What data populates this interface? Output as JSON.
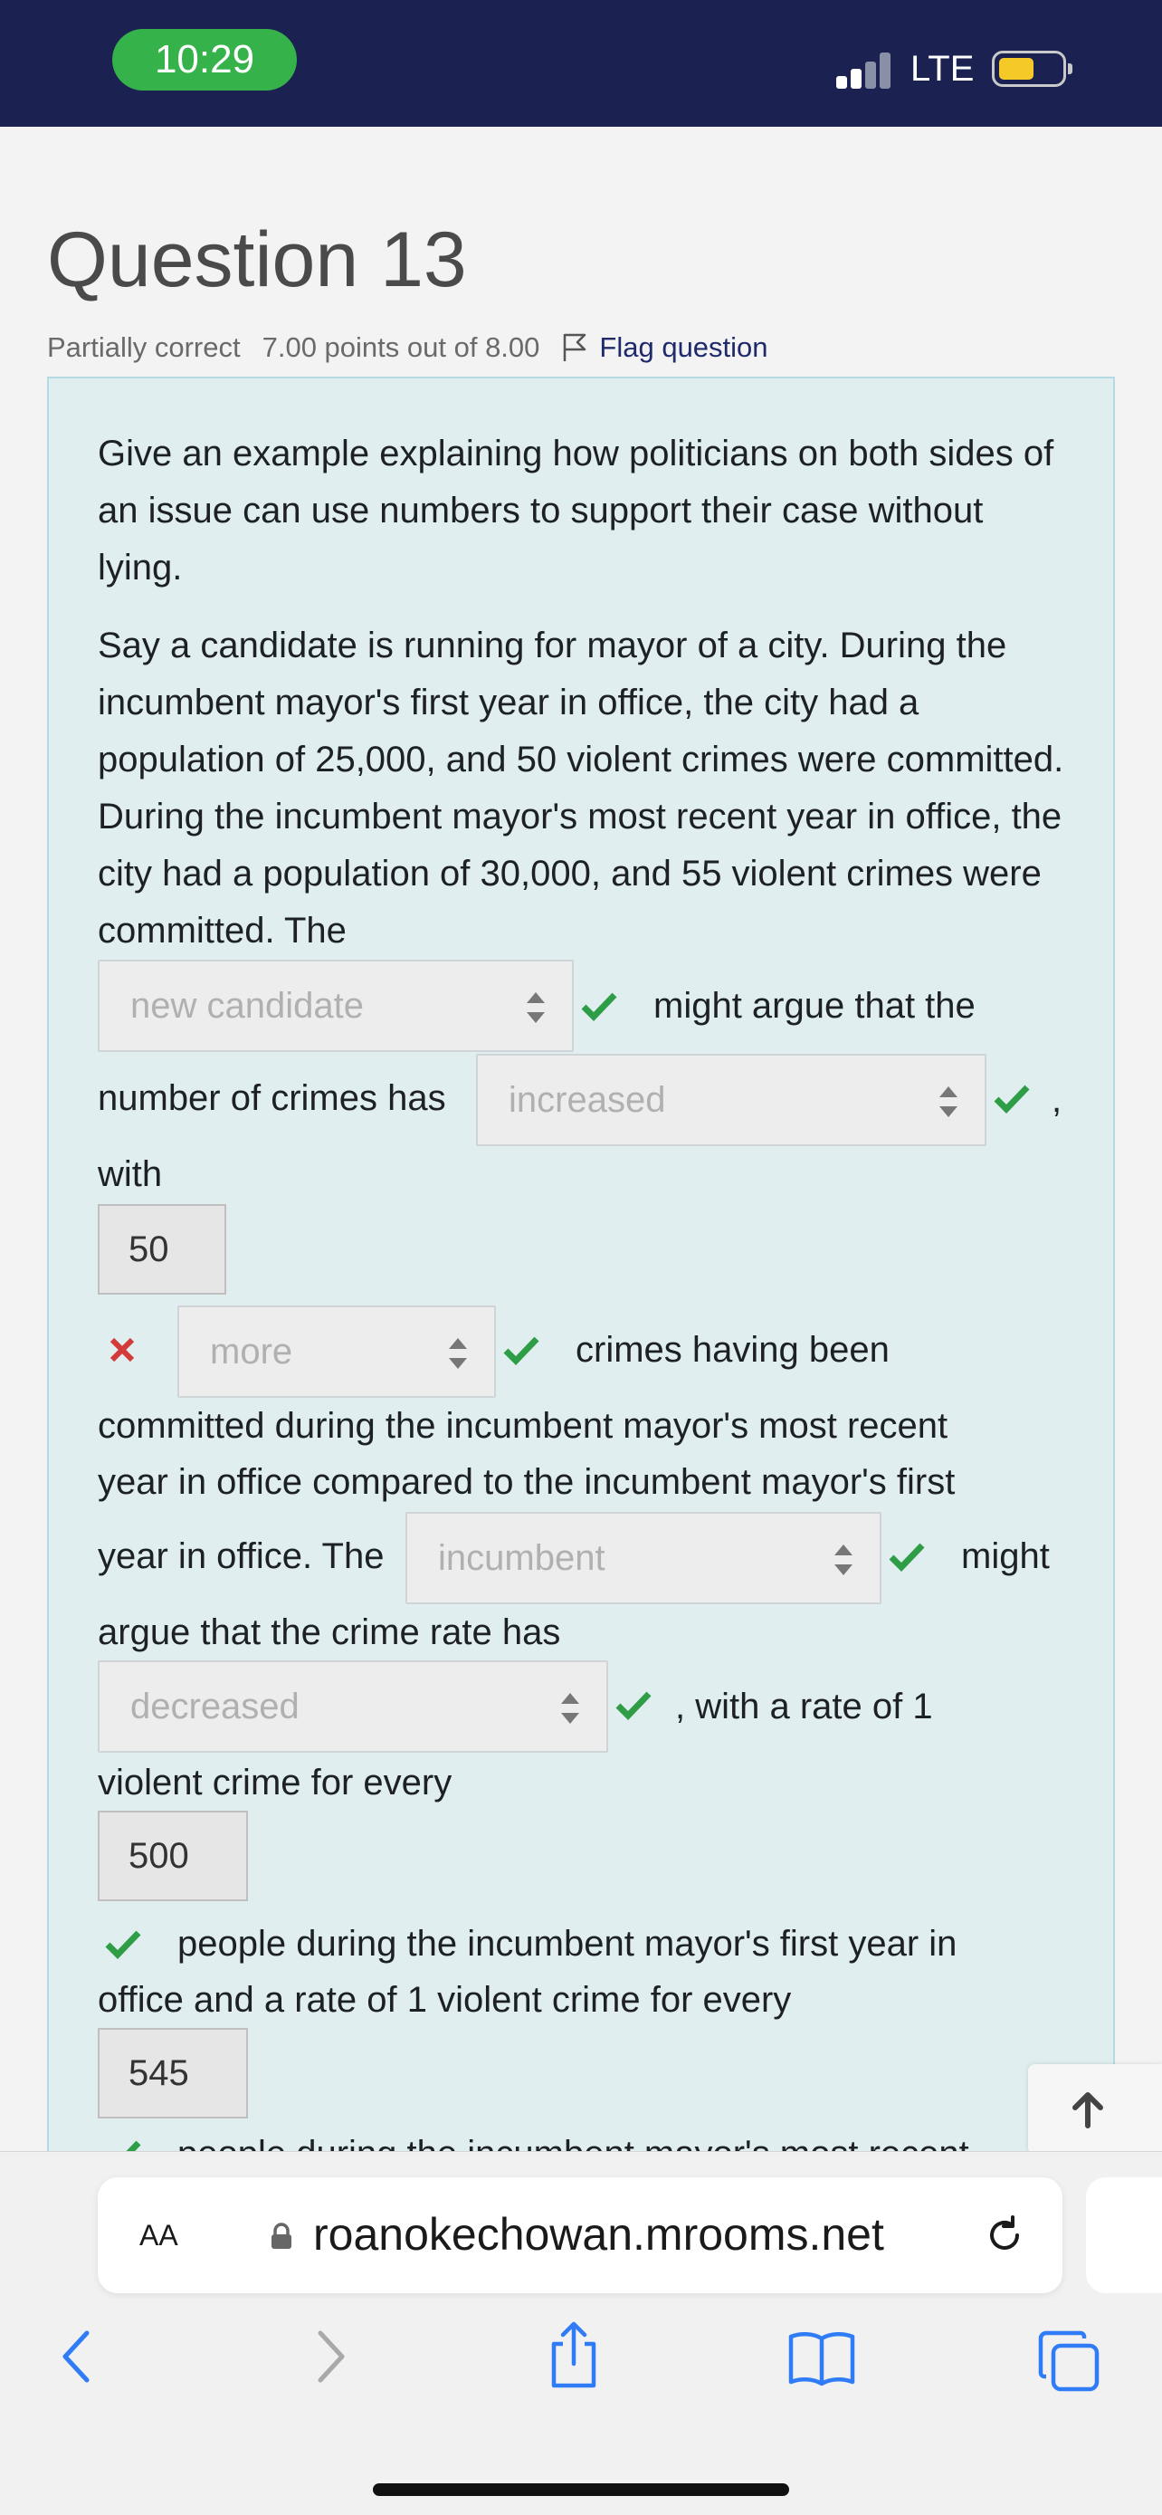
{
  "status_bar": {
    "time": "10:29",
    "network": "LTE"
  },
  "question": {
    "title": "Question 13",
    "state": "Partially correct",
    "points": "7.00 points out of 8.00",
    "flag_label": "Flag question"
  },
  "content": {
    "prompt": "Give an example explaining how politicians on both sides of an issue can use numbers to support their case without lying.",
    "scenario": "Say a candidate is running for mayor of a city. During the incumbent mayor's first year in office, the city had a population of 25,000, and 50 violent crimes were committed. During the incumbent mayor's most recent year in office, the city had a population of 30,000, and 55 violent crimes were committed. The",
    "t1": "might argue that the",
    "t2": "number of crimes has",
    "t2b": ",",
    "t3": "with",
    "t4": "crimes having been",
    "t5a": "committed during the incumbent mayor's most recent",
    "t5b": "year in office compared to the incumbent mayor's first",
    "t6": "year in office. The",
    "t6b": "might",
    "t7": "argue that the crime rate has",
    "t8": ", with a rate of 1",
    "t9": "violent crime for every",
    "t10a": "people during the incumbent mayor's first year in",
    "t10b": "office and a rate of 1 violent crime for every",
    "t11": "people during the incumbent mayor's most recent"
  },
  "answers": {
    "select1": "new candidate",
    "select2": "increased",
    "input1": "50",
    "select3": "more",
    "select4": "incumbent",
    "select5": "decreased",
    "input2": "500",
    "input3": "545"
  },
  "browser": {
    "text_size": "AA",
    "url": "roanokechowan.mrooms.net"
  },
  "colors": {
    "correct": "#2e9d46",
    "incorrect": "#d33a3a",
    "panel": "#e0eef0",
    "status_bar": "#1b2150"
  }
}
